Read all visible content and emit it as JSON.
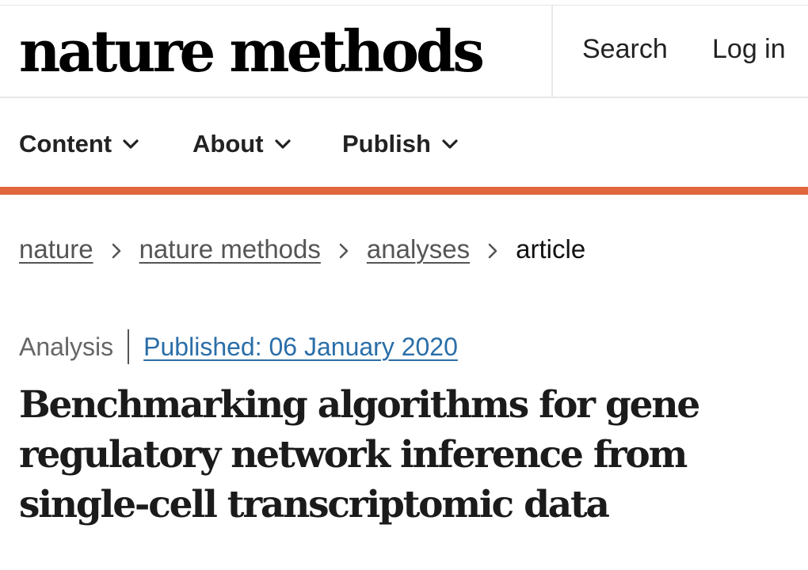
{
  "header": {
    "brand": "nature methods",
    "search_label": "Search",
    "login_label": "Log in"
  },
  "nav": {
    "items": [
      {
        "label": "Content",
        "icon": "chevron-down-icon"
      },
      {
        "label": "About",
        "icon": "chevron-down-icon"
      },
      {
        "label": "Publish",
        "icon": "chevron-down-icon"
      }
    ],
    "accent_color": "#e0663d"
  },
  "breadcrumb": {
    "items": [
      "nature",
      "nature methods",
      "analyses"
    ],
    "current": "article",
    "separator_icon": "chevron-right-icon"
  },
  "article": {
    "type": "Analysis",
    "published": "Published: 06 January 2020",
    "title_lines": [
      "Benchmarking algorithms for gene",
      "regulatory network inference from",
      "single-cell transcriptomic data"
    ]
  },
  "colors": {
    "link_blue": "#2a6ea8",
    "text": "#222222",
    "accent": "#e0663d"
  }
}
